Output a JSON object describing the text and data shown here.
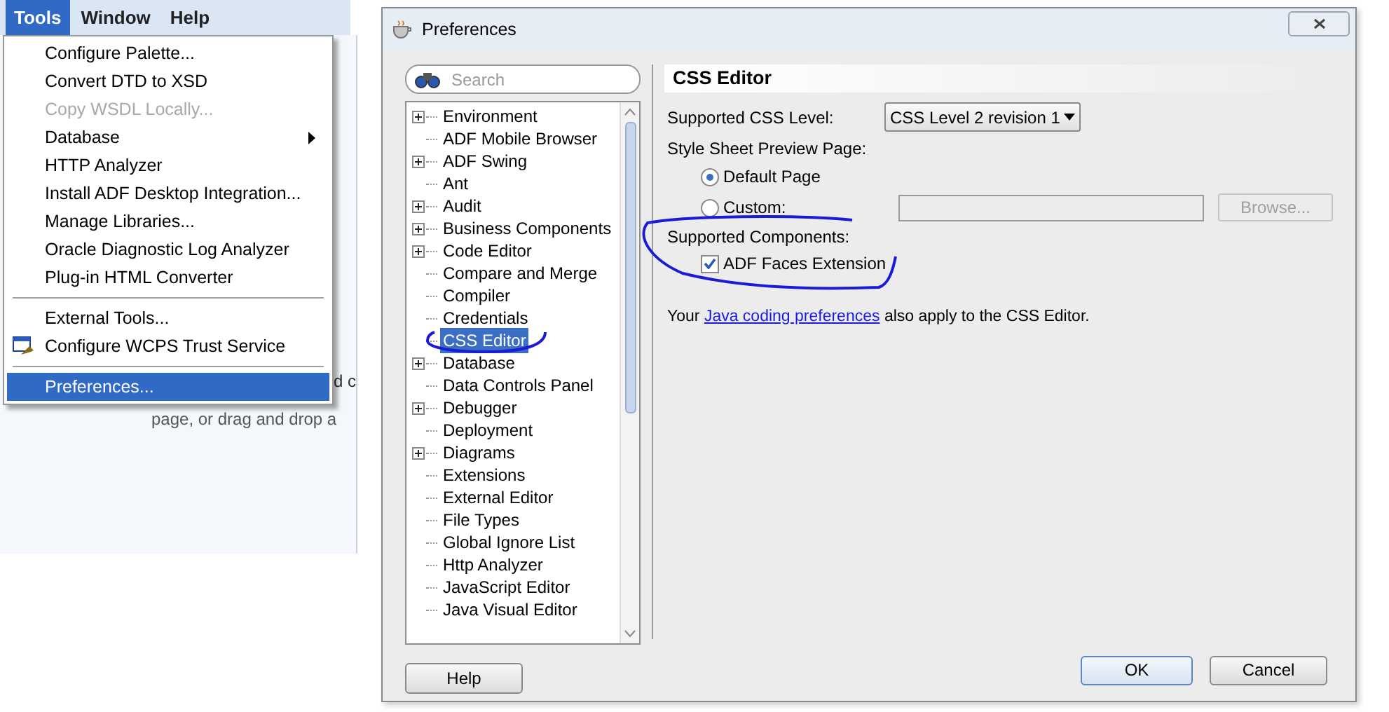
{
  "menu_bar": {
    "items": [
      {
        "label": "Tools",
        "selected": true
      },
      {
        "label": "Window",
        "selected": false
      },
      {
        "label": "Help",
        "selected": false
      }
    ]
  },
  "background_text": [
    "d c",
    "page, or drag and drop a"
  ],
  "tools_menu": {
    "items": [
      {
        "kind": "item",
        "label": "Configure Palette...",
        "disabled": false,
        "selected": false
      },
      {
        "kind": "item",
        "label": "Convert DTD to XSD",
        "disabled": false,
        "selected": false
      },
      {
        "kind": "item",
        "label": "Copy WSDL Locally...",
        "disabled": true,
        "selected": false
      },
      {
        "kind": "submenu",
        "label": "Database",
        "disabled": false,
        "selected": false
      },
      {
        "kind": "item",
        "label": "HTTP Analyzer",
        "disabled": false,
        "selected": false
      },
      {
        "kind": "item",
        "label": "Install ADF Desktop Integration...",
        "disabled": false,
        "selected": false
      },
      {
        "kind": "item",
        "label": "Manage Libraries...",
        "disabled": false,
        "selected": false
      },
      {
        "kind": "item",
        "label": "Oracle Diagnostic Log Analyzer",
        "disabled": false,
        "selected": false
      },
      {
        "kind": "item",
        "label": "Plug-in HTML Converter",
        "disabled": false,
        "selected": false
      },
      {
        "kind": "separator"
      },
      {
        "kind": "item",
        "label": "External Tools...",
        "disabled": false,
        "selected": false
      },
      {
        "kind": "icon_item",
        "label": "Configure WCPS Trust Service",
        "disabled": false,
        "selected": false
      },
      {
        "kind": "separator"
      },
      {
        "kind": "item",
        "label": "Preferences...",
        "disabled": false,
        "selected": true
      }
    ]
  },
  "dialog": {
    "title": "Preferences",
    "search": {
      "placeholder": "Search"
    },
    "tree": [
      {
        "label": "Environment",
        "expandable": true,
        "selected": false
      },
      {
        "label": "ADF Mobile Browser",
        "expandable": false,
        "selected": false
      },
      {
        "label": "ADF Swing",
        "expandable": true,
        "selected": false
      },
      {
        "label": "Ant",
        "expandable": false,
        "selected": false
      },
      {
        "label": "Audit",
        "expandable": true,
        "selected": false
      },
      {
        "label": "Business Components",
        "expandable": true,
        "selected": false
      },
      {
        "label": "Code Editor",
        "expandable": true,
        "selected": false
      },
      {
        "label": "Compare and Merge",
        "expandable": false,
        "selected": false
      },
      {
        "label": "Compiler",
        "expandable": false,
        "selected": false
      },
      {
        "label": "Credentials",
        "expandable": false,
        "selected": false
      },
      {
        "label": "CSS Editor",
        "expandable": false,
        "selected": true
      },
      {
        "label": "Database",
        "expandable": true,
        "selected": false
      },
      {
        "label": "Data Controls Panel",
        "expandable": false,
        "selected": false
      },
      {
        "label": "Debugger",
        "expandable": true,
        "selected": false
      },
      {
        "label": "Deployment",
        "expandable": false,
        "selected": false
      },
      {
        "label": "Diagrams",
        "expandable": true,
        "selected": false
      },
      {
        "label": "Extensions",
        "expandable": false,
        "selected": false
      },
      {
        "label": "External Editor",
        "expandable": false,
        "selected": false
      },
      {
        "label": "File Types",
        "expandable": false,
        "selected": false
      },
      {
        "label": "Global Ignore List",
        "expandable": false,
        "selected": false
      },
      {
        "label": "Http Analyzer",
        "expandable": false,
        "selected": false
      },
      {
        "label": "JavaScript Editor",
        "expandable": false,
        "selected": false
      },
      {
        "label": "Java Visual Editor",
        "expandable": false,
        "selected": false
      }
    ],
    "panel": {
      "heading": "CSS Editor",
      "css_level_label": "Supported CSS Level:",
      "css_level_value": "CSS Level 2 revision 1",
      "preview_label": "Style Sheet Preview Page:",
      "radios": [
        {
          "label": "Default Page",
          "selected": true
        },
        {
          "label": "Custom:",
          "selected": false
        }
      ],
      "browse_button": {
        "label": "Browse...",
        "disabled": true
      },
      "components_label": "Supported Components:",
      "checkbox": {
        "label": "ADF Faces Extension",
        "checked": true
      },
      "note_before": "Your ",
      "note_link": "Java coding preferences",
      "note_after": " also apply to the CSS Editor."
    },
    "buttons": {
      "help": "Help",
      "ok": "OK",
      "cancel": "Cancel"
    }
  }
}
